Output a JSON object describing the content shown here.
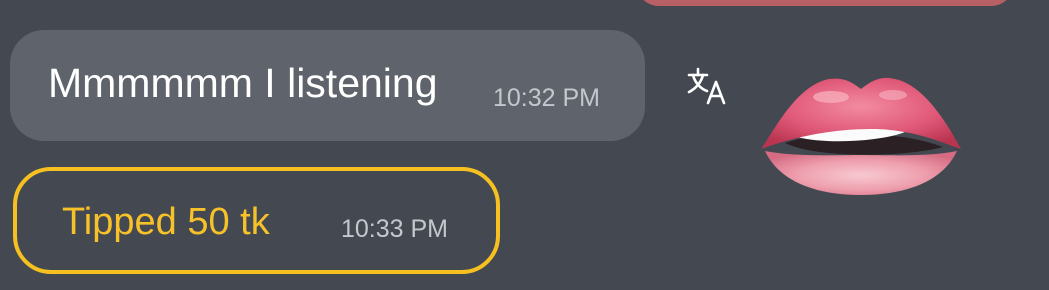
{
  "messages": {
    "incoming": {
      "text": "Mmmmmm I listening",
      "time": "10:32 PM"
    },
    "tip": {
      "text": "Tipped 50 tk",
      "time": "10:33 PM"
    }
  },
  "icons": {
    "translate": "translate-icon",
    "reaction": "lips-emoji"
  },
  "colors": {
    "background": "#444951",
    "incoming_bubble": "#5f636b",
    "tip_accent": "#f5c020",
    "outgoing_bubble": "#b95f66"
  }
}
